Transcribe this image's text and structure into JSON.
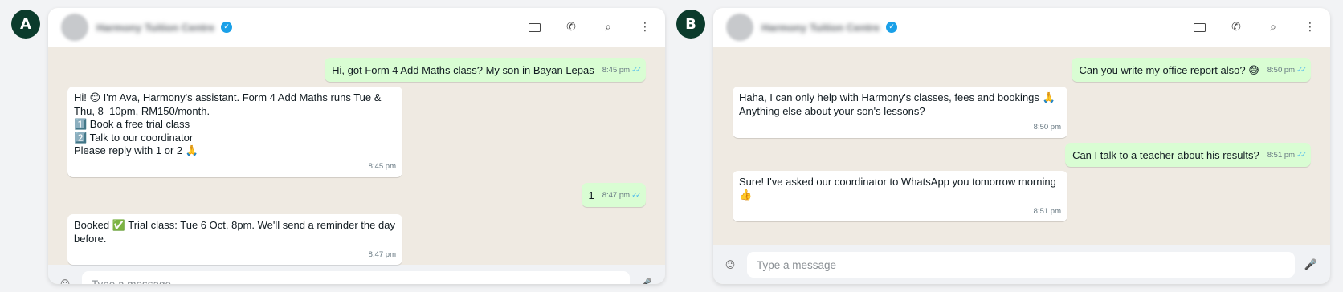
{
  "panels": [
    {
      "badge": "A",
      "contact_name": "Harmony Tuition Centre",
      "verified_icon": "verified-check-icon",
      "header_icons": [
        "video-call-icon",
        "voice-call-icon",
        "search-icon",
        "more-options-icon"
      ],
      "messages": [
        {
          "direction": "out",
          "text": "Hi, got Form 4 Add Maths class? My son in Bayan Lepas",
          "time": "8:45 pm",
          "ticks": "✓✓"
        },
        {
          "direction": "in",
          "text": "Hi! 😊 I'm Ava, Harmony's assistant. Form 4 Add Maths runs Tue & Thu, 8–10pm, RM150/month.\n1️⃣ Book a free trial class\n2️⃣ Talk to our coordinator\nPlease reply with 1 or 2 🙏",
          "time": "8:45 pm"
        },
        {
          "direction": "out",
          "text": "1",
          "time": "8:47 pm",
          "ticks": "✓✓"
        },
        {
          "direction": "in",
          "text": "Booked ✅ Trial class: Tue 6 Oct, 8pm. We'll send a reminder the day before.",
          "time": "8:47 pm"
        }
      ],
      "input": {
        "placeholder": "Type a message",
        "value": ""
      },
      "input_icons": [
        "emoji-icon",
        "mic-icon"
      ]
    },
    {
      "badge": "B",
      "contact_name": "Harmony Tuition Centre",
      "verified_icon": "verified-check-icon",
      "header_icons": [
        "video-call-icon",
        "voice-call-icon",
        "search-icon",
        "more-options-icon"
      ],
      "messages": [
        {
          "direction": "out",
          "text": "Can you write my office report also? 😅",
          "time": "8:50 pm",
          "ticks": "✓✓"
        },
        {
          "direction": "in",
          "text": "Haha, I can only help with Harmony's classes, fees and bookings 🙏 Anything else about your son's lessons?",
          "time": "8:50 pm"
        },
        {
          "direction": "out",
          "text": "Can I talk to a teacher about his results?",
          "time": "8:51 pm",
          "ticks": "✓✓"
        },
        {
          "direction": "in",
          "text": "Sure! I've asked our coordinator to WhatsApp you tomorrow morning 👍",
          "time": "8:51 pm"
        }
      ],
      "input": {
        "placeholder": "Type a message",
        "value": ""
      },
      "input_icons": [
        "emoji-icon",
        "mic-icon"
      ]
    }
  ],
  "colors": {
    "outgoing_bubble": "#d9fdd3",
    "incoming_bubble": "#ffffff",
    "chat_background": "#efeae2",
    "badge": "#0b3b2c",
    "verified": "#1aa0e8",
    "read_ticks": "#53bdeb"
  }
}
